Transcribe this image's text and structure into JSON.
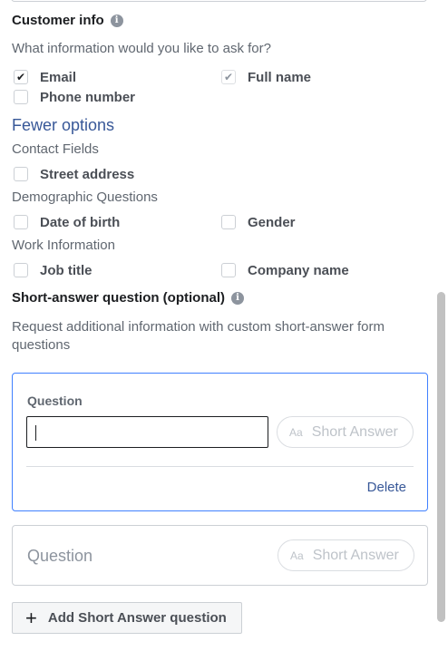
{
  "customer_info": {
    "title": "Customer info",
    "info_icon": "info-icon",
    "prompt": "What information would you like to ask for?",
    "fields": [
      {
        "label": "Email",
        "checked": true,
        "disabled": false
      },
      {
        "label": "Full name",
        "checked": true,
        "disabled": true
      },
      {
        "label": "Phone number",
        "checked": false,
        "disabled": false
      }
    ],
    "toggle_link": "Fewer options",
    "groups": [
      {
        "heading": "Contact Fields",
        "items": [
          {
            "label": "Street address",
            "checked": false
          }
        ]
      },
      {
        "heading": "Demographic Questions",
        "items": [
          {
            "label": "Date of birth",
            "checked": false
          },
          {
            "label": "Gender",
            "checked": false
          }
        ]
      },
      {
        "heading": "Work Information",
        "items": [
          {
            "label": "Job title",
            "checked": false
          },
          {
            "label": "Company name",
            "checked": false
          }
        ]
      }
    ]
  },
  "short_answer": {
    "title": "Short-answer question (optional)",
    "info_icon": "info-icon",
    "description": "Request additional information with custom short-answer form questions",
    "active_question": {
      "label": "Question",
      "value": "",
      "type_pill": "Short Answer",
      "type_icon": "Aa",
      "delete_label": "Delete"
    },
    "collapsed_question": {
      "placeholder": "Question",
      "type_pill": "Short Answer",
      "type_icon": "Aa"
    },
    "add_button": "Add Short Answer question",
    "add_icon": "plus-icon"
  },
  "colors": {
    "link": "#385898",
    "active_border": "#4080ff",
    "muted_text": "#606770"
  }
}
